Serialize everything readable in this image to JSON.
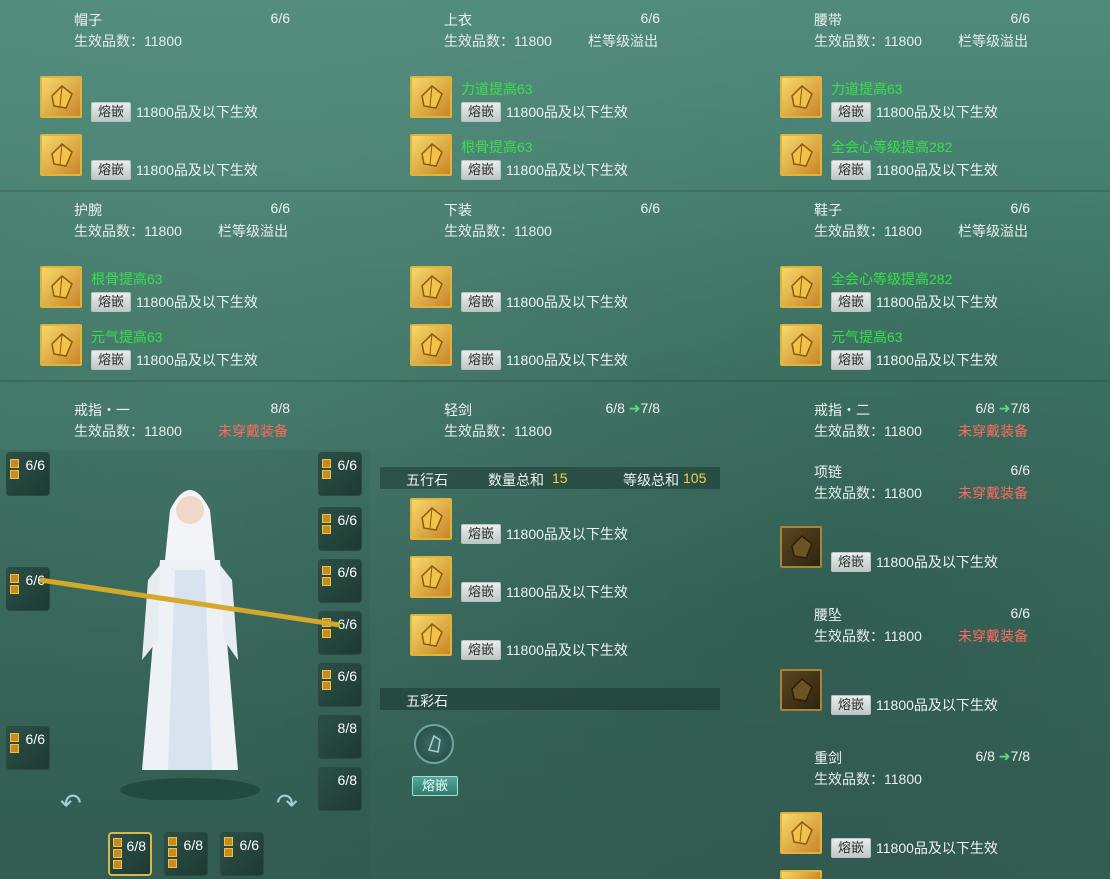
{
  "labels": {
    "set_gem": "五行石",
    "count_total_label": "数量总和",
    "level_total_label": "等级总和",
    "colorful_stone": "五彩石",
    "inlay": "熔嵌"
  },
  "summary": {
    "count_total": "15",
    "level_total": "105"
  },
  "equipment": [
    {
      "name": "帽子",
      "count": "6/6",
      "sub": "生效品数：11800",
      "note": "",
      "slots": [
        {
          "attr": "",
          "eff": "11800品及以下生效"
        },
        {
          "attr": "",
          "eff": "11800品及以下生效"
        }
      ]
    },
    {
      "name": "上衣",
      "count": "6/6",
      "sub": "生效品数：11800",
      "note": "栏等级溢出",
      "slots": [
        {
          "attr": "力道提高63",
          "eff": "11800品及以下生效"
        },
        {
          "attr": "根骨提高63",
          "eff": "11800品及以下生效"
        }
      ]
    },
    {
      "name": "腰带",
      "count": "6/6",
      "sub": "生效品数：11800",
      "note": "栏等级溢出",
      "slots": [
        {
          "attr": "力道提高63",
          "eff": "11800品及以下生效"
        },
        {
          "attr": "全会心等级提高282",
          "eff": "11800品及以下生效"
        }
      ]
    },
    {
      "name": "护腕",
      "count": "6/6",
      "sub": "生效品数：11800",
      "note": "栏等级溢出",
      "slots": [
        {
          "attr": "根骨提高63",
          "eff": "11800品及以下生效"
        },
        {
          "attr": "元气提高63",
          "eff": "11800品及以下生效"
        }
      ]
    },
    {
      "name": "下装",
      "count": "6/6",
      "sub": "生效品数：11800",
      "note": "",
      "slots": [
        {
          "attr": "",
          "eff": "11800品及以下生效"
        },
        {
          "attr": "",
          "eff": "11800品及以下生效"
        }
      ]
    },
    {
      "name": "鞋子",
      "count": "6/6",
      "sub": "生效品数：11800",
      "note": "栏等级溢出",
      "slots": [
        {
          "attr": "全会心等级提高282",
          "eff": "11800品及以下生效"
        },
        {
          "attr": "元气提高63",
          "eff": "11800品及以下生效"
        }
      ]
    },
    {
      "name": "戒指・一",
      "count": "8/8",
      "sub": "生效品数：11800",
      "note": "未穿戴装备"
    },
    {
      "name": "轻剑",
      "count": "6/8",
      "count_next": "7/8",
      "sub": "生效品数：11800",
      "note": ""
    },
    {
      "name": "戒指・二",
      "count": "6/8",
      "count_next": "7/8",
      "sub": "生效品数：11800",
      "note": "未穿戴装备"
    },
    {
      "name": "项链",
      "count": "6/6",
      "sub": "生效品数：11800",
      "note": "未穿戴装备",
      "slots": [
        {
          "attr": "",
          "eff": "11800品及以下生效"
        }
      ]
    },
    {
      "name": "腰坠",
      "count": "6/6",
      "sub": "生效品数：11800",
      "note": "未穿戴装备",
      "slots": [
        {
          "attr": "",
          "eff": "11800品及以下生效"
        }
      ]
    },
    {
      "name": "重剑",
      "count": "6/8",
      "count_next": "7/8",
      "sub": "生效品数：11800",
      "note": "",
      "slots": [
        {
          "attr": "",
          "eff": "11800品及以下生效"
        }
      ]
    }
  ],
  "wuxing_slots": [
    {
      "eff": "11800品及以下生效"
    },
    {
      "eff": "11800品及以下生效"
    },
    {
      "eff": "11800品及以下生效"
    }
  ],
  "character_slots": {
    "left": [
      "6/6",
      "6/6",
      "6/6"
    ],
    "right": [
      "6/6",
      "6/6",
      "6/6",
      "6/6",
      "6/6",
      "8/8",
      "6/8"
    ],
    "bottom": [
      "6/8",
      "6/8",
      "6/6"
    ]
  },
  "colors": {
    "green_attr": "#38e04c",
    "red_note": "#ff6a5c",
    "gold": "#e0b33a",
    "accent_yellow": "#f5d040"
  }
}
